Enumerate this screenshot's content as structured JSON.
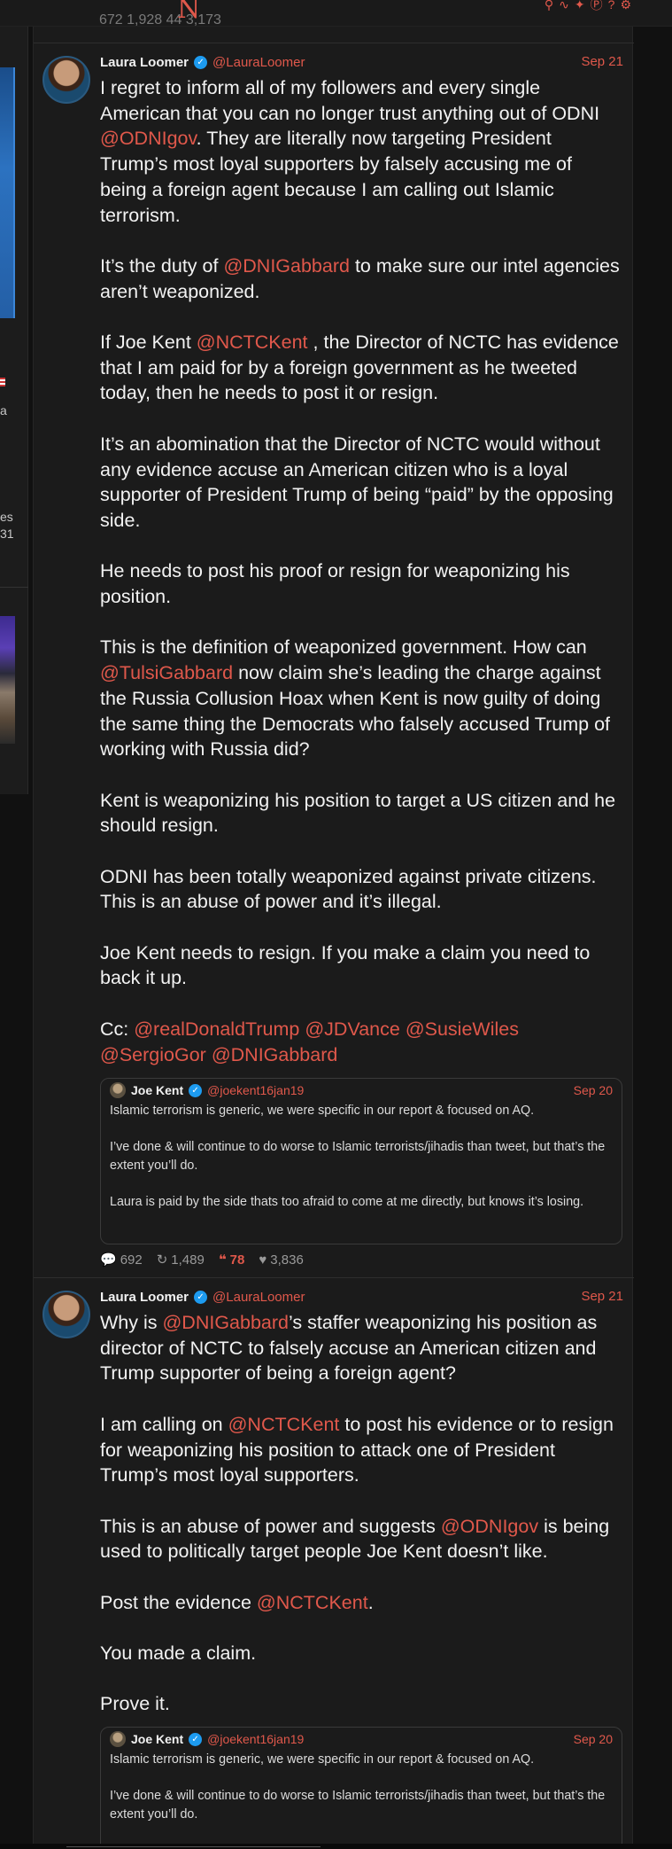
{
  "top": {
    "logo": "N",
    "cut_stats": "672  1,928  44  3,173"
  },
  "posts": [
    {
      "author": "Laura Loomer",
      "handle": "@LauraLoomer",
      "date": "Sep 21",
      "paragraphs": [
        [
          {
            "t": "I regret to inform all of my followers and every single American that you can no longer trust anything out of ODNI "
          },
          {
            "m": "@ODNIgov"
          },
          {
            "t": ". They are literally now targeting President Trump’s most loyal supporters by falsely accusing me of being a foreign agent because I am calling out Islamic terrorism."
          }
        ],
        [
          {
            "t": "It’s the duty of "
          },
          {
            "m": "@DNIGabbard"
          },
          {
            "t": " to make sure our intel agencies aren’t weaponized."
          }
        ],
        [
          {
            "t": "If Joe Kent "
          },
          {
            "m": "@NCTCKent"
          },
          {
            "t": " , the Director of NCTC has evidence that I am paid for by a foreign government as he tweeted today, then he needs to post it or resign."
          }
        ],
        [
          {
            "t": "It’s an abomination that the Director of NCTC would without any evidence accuse an American citizen who is a loyal supporter of President Trump of being “paid” by the opposing side."
          }
        ],
        [
          {
            "t": "He needs to post his proof or resign for weaponizing his position."
          }
        ],
        [
          {
            "t": "This is the definition of weaponized government. How can "
          },
          {
            "m": "@TulsiGabbard"
          },
          {
            "t": " now claim she’s leading the charge against the Russia Collusion Hoax when Kent is now guilty of doing the same thing the Democrats who falsely accused Trump of working with Russia did?"
          }
        ],
        [
          {
            "t": "Kent is weaponizing his position to target a US citizen and he should resign."
          }
        ],
        [
          {
            "t": "ODNI has been totally weaponized against private citizens. This is an abuse of power and it’s illegal."
          }
        ],
        [
          {
            "t": "Joe Kent needs to resign. If you make a claim you need to back it up."
          }
        ],
        [
          {
            "t": "Cc: "
          },
          {
            "m": "@realDonaldTrump"
          },
          {
            "t": " "
          },
          {
            "m": "@JDVance"
          },
          {
            "t": " "
          },
          {
            "m": "@SusieWiles"
          },
          {
            "t": " "
          },
          {
            "m": "@SergioGor"
          },
          {
            "t": " "
          },
          {
            "m": "@DNIGabbard"
          }
        ]
      ],
      "quote": {
        "author": "Joe Kent",
        "handle": "@joekent16jan19",
        "date": "Sep 20",
        "paragraphs": [
          "Islamic terrorism is generic, we were specific in our report & focused on AQ.",
          "I’ve done & will continue to do worse to Islamic terrorists/jihadis than tweet, but that’s the extent you’ll do.",
          "Laura is paid by the side thats too afraid to come at me directly, but knows it’s losing."
        ]
      },
      "stats": {
        "replies": "692",
        "reposts": "1,489",
        "quotes": "78",
        "likes": "3,836"
      }
    },
    {
      "author": "Laura Loomer",
      "handle": "@LauraLoomer",
      "date": "Sep 21",
      "paragraphs": [
        [
          {
            "t": "Why is "
          },
          {
            "m": "@DNIGabbard"
          },
          {
            "t": "’s staffer weaponizing his position as director of NCTC to falsely accuse an American citizen and Trump supporter of being a foreign agent?"
          }
        ],
        [
          {
            "t": "I am calling on "
          },
          {
            "m": "@NCTCKent"
          },
          {
            "t": " to post his evidence or to resign for weaponizing his position to attack one of President Trump’s most loyal supporters."
          }
        ],
        [
          {
            "t": "This is an abuse of power and suggests "
          },
          {
            "m": "@ODNIgov"
          },
          {
            "t": " is being used to politically target people Joe Kent doesn’t like."
          }
        ],
        [
          {
            "t": "Post the evidence "
          },
          {
            "m": "@NCTCKent"
          },
          {
            "t": "."
          }
        ],
        [
          {
            "t": "You made a claim."
          }
        ],
        [
          {
            "t": "Prove it."
          }
        ]
      ],
      "quote": {
        "author": "Joe Kent",
        "handle": "@joekent16jan19",
        "date": "Sep 20",
        "paragraphs": [
          "Islamic terrorism is generic, we were specific in our report & focused on AQ.",
          "I’ve done & will continue to do worse to Islamic terrorists/jihadis than tweet, but that’s the extent you’ll do."
        ]
      }
    }
  ],
  "left": {
    "frag1": "a",
    "frag2": "es",
    "frag3": "31"
  },
  "icons": [
    "search-icon",
    "rss-icon",
    "twitter-icon",
    "pinterest-icon",
    "help-icon",
    "gear-icon"
  ],
  "colors": {
    "accent": "#e0584b",
    "verified": "#1d9bf0",
    "background": "#111111",
    "panel": "#1b1b1b"
  }
}
